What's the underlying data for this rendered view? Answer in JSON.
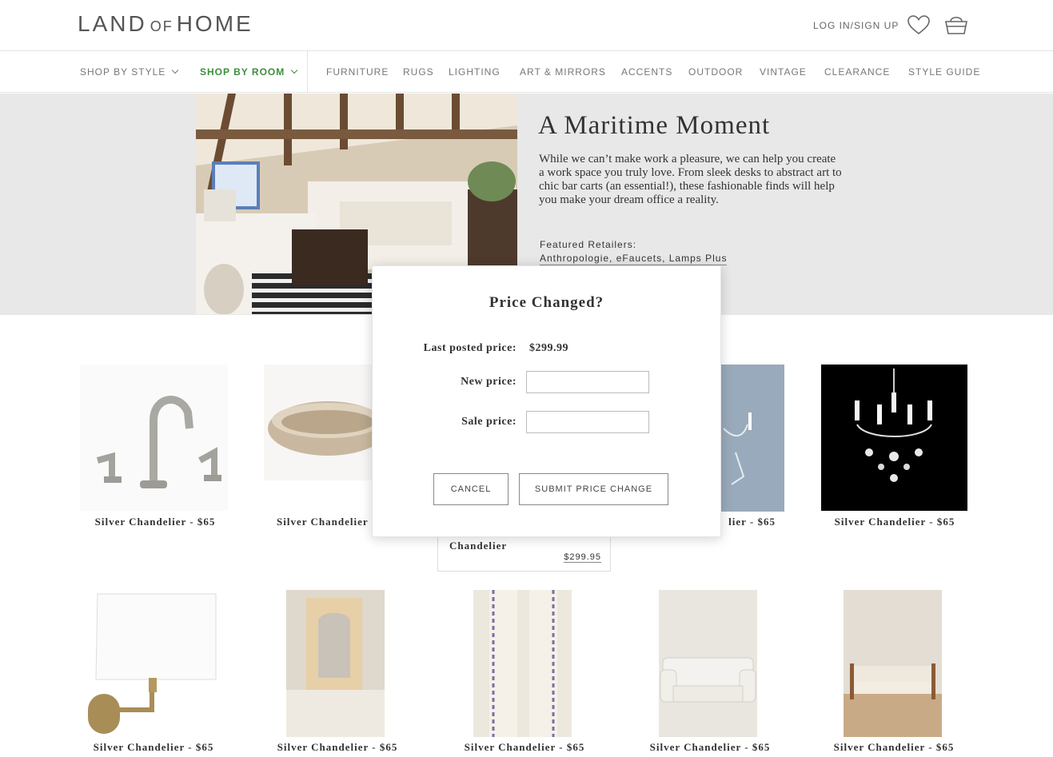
{
  "header": {
    "logo_main": "LAND",
    "logo_of": "OF",
    "logo_end": "HOME",
    "login_label": "LOG IN/SIGN UP"
  },
  "nav": {
    "shop_by_style": "SHOP BY STYLE",
    "shop_by_room": "SHOP BY ROOM",
    "items": [
      "FURNITURE",
      "RUGS",
      "LIGHTING",
      "ART & MIRRORS",
      "ACCENTS",
      "OUTDOOR",
      "VINTAGE",
      "CLEARANCE",
      "STYLE GUIDE"
    ]
  },
  "hero": {
    "title": "A Maritime Moment",
    "body": "While we can’t make work a pleasure, we can help you create a work space you truly love. From sleek desks to abstract art to chic bar carts (an essential!), these fashionable finds will help you make your dream office a reality.",
    "featured_label": "Featured Retailers:",
    "featured_links": "Anthropologie, eFaucets, Lamps Plus"
  },
  "products": {
    "row1": [
      "Silver Chandelier - $65",
      "Silver Chandelier",
      "Silver Chandelier - $65",
      "Silver Chandelier - $65"
    ],
    "row1_partial": "lier - $65",
    "row2": [
      "Silver Chandelier - $65",
      "Silver Chandelier - $65",
      "Silver Chandelier - $65",
      "Silver Chandelier - $65",
      "Silver Chandelier - $65"
    ],
    "peek_card": {
      "title": "Chandelier",
      "price": "$299.95"
    }
  },
  "modal": {
    "title": "Price Changed?",
    "last_posted_label": "Last posted price:",
    "last_posted_value": "$299.99",
    "new_price_label": "New price:",
    "new_price_value": "",
    "sale_price_label": "Sale price:",
    "sale_price_value": "",
    "cancel_label": "CANCEL",
    "submit_label": "SUBMIT PRICE CHANGE"
  },
  "colors": {
    "accent_green": "#3c8f3c",
    "hero_bg": "#e8e8e8"
  }
}
